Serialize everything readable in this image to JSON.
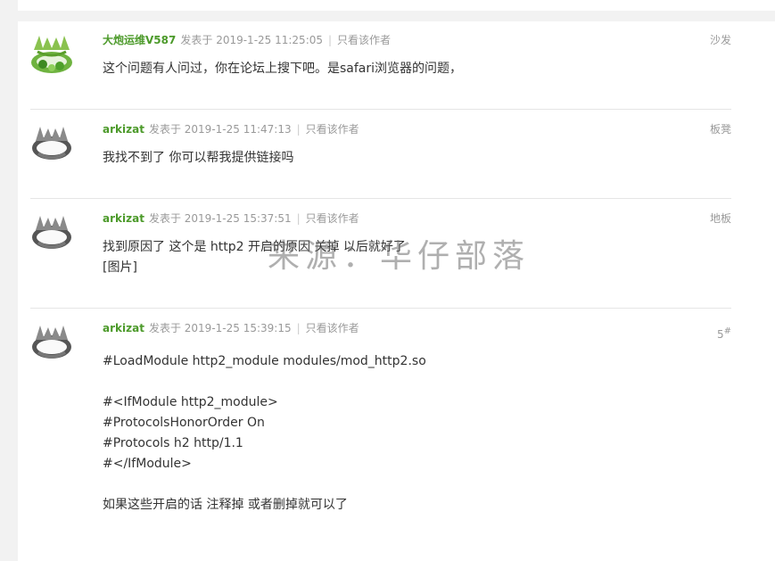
{
  "posts": [
    {
      "author": "大炮运维V587",
      "posted_prefix": "发表于",
      "posted_time": "2019-1-25 11:25:05",
      "separator": "|",
      "only_author": "只看该作者",
      "floor": "沙发",
      "avatar_icon": "crown-avatar-green-icon",
      "content": "这个问题有人问过，你在论坛上搜下吧。是safari浏览器的问题，"
    },
    {
      "author": "arkizat",
      "posted_prefix": "发表于",
      "posted_time": "2019-1-25 11:47:13",
      "separator": "|",
      "only_author": "只看该作者",
      "floor": "板凳",
      "avatar_icon": "crown-avatar-grey-icon",
      "content": "我找不到了  你可以帮我提供链接吗"
    },
    {
      "author": "arkizat",
      "posted_prefix": "发表于",
      "posted_time": "2019-1-25 15:37:51",
      "separator": "|",
      "only_author": "只看该作者",
      "floor": "地板",
      "avatar_icon": "crown-avatar-grey-icon",
      "content": "找到原因了  这个是 http2 开启的原因 关掉 以后就好了\n[图片]"
    },
    {
      "author": "arkizat",
      "posted_prefix": "发表于",
      "posted_time": "2019-1-25 15:39:15",
      "separator": "|",
      "only_author": "只看该作者",
      "floor": "5",
      "floor_suffix": "#",
      "avatar_icon": "crown-avatar-grey-icon",
      "content": "#LoadModule http2_module modules/mod_http2.so\n\n#<IfModule http2_module>\n#ProtocolsHonorOrder On\n#Protocols h2 http/1.1\n#</IfModule>\n\n如果这些开启的话 注释掉 或者删掉就可以了"
    }
  ],
  "watermark": "来源：华仔部落",
  "colors": {
    "author": "#4c9a2a",
    "meta": "#999999",
    "divider": "#e5e5e5"
  }
}
